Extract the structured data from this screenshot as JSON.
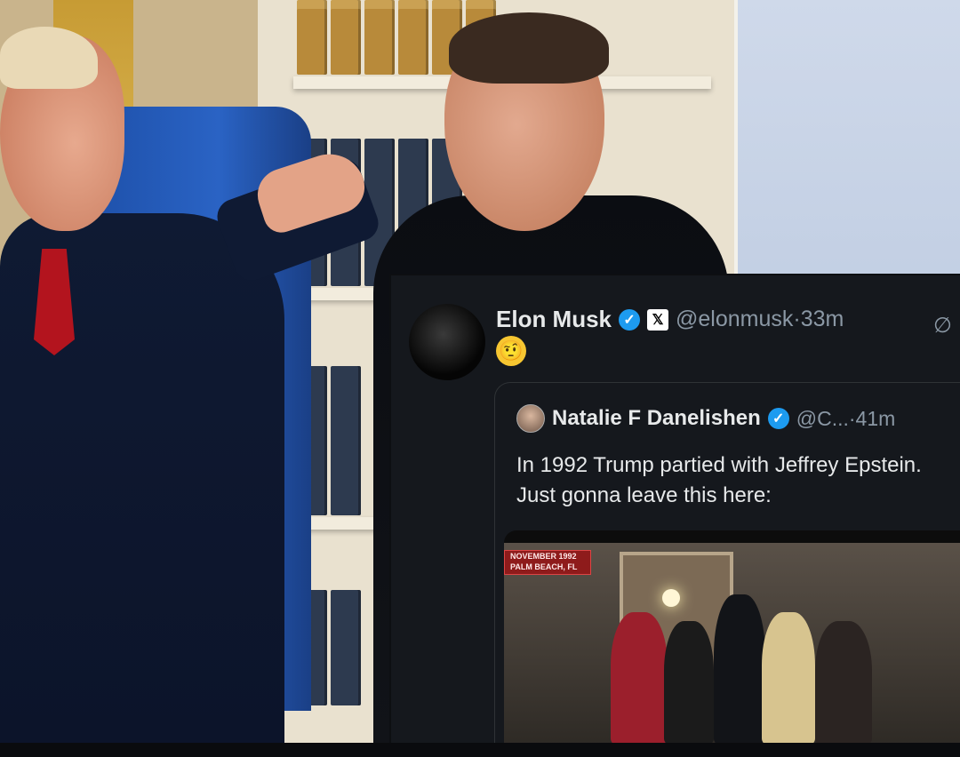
{
  "tweet": {
    "author_name": "Elon Musk",
    "handle_time": "@elonmusk·33m",
    "emoji": "🤨",
    "quoted": {
      "author_name": "Natalie F Danelishen",
      "handle_time": "@C...·41m",
      "text": "In 1992 Trump partied with Jeffrey Epstein. Just gonna leave this here:",
      "media_caption_line1": "NOVEMBER 1992",
      "media_caption_line2": "PALM BEACH, FL"
    }
  },
  "icons": {
    "verified": "verified-badge-icon",
    "x_logo": "x-logo-icon",
    "grok": "grok-slash-icon"
  },
  "colors": {
    "card_background": "#15181d",
    "verified_blue": "#1d9bf0",
    "text_primary": "#e7e9ea",
    "text_secondary": "#8b98a5"
  }
}
